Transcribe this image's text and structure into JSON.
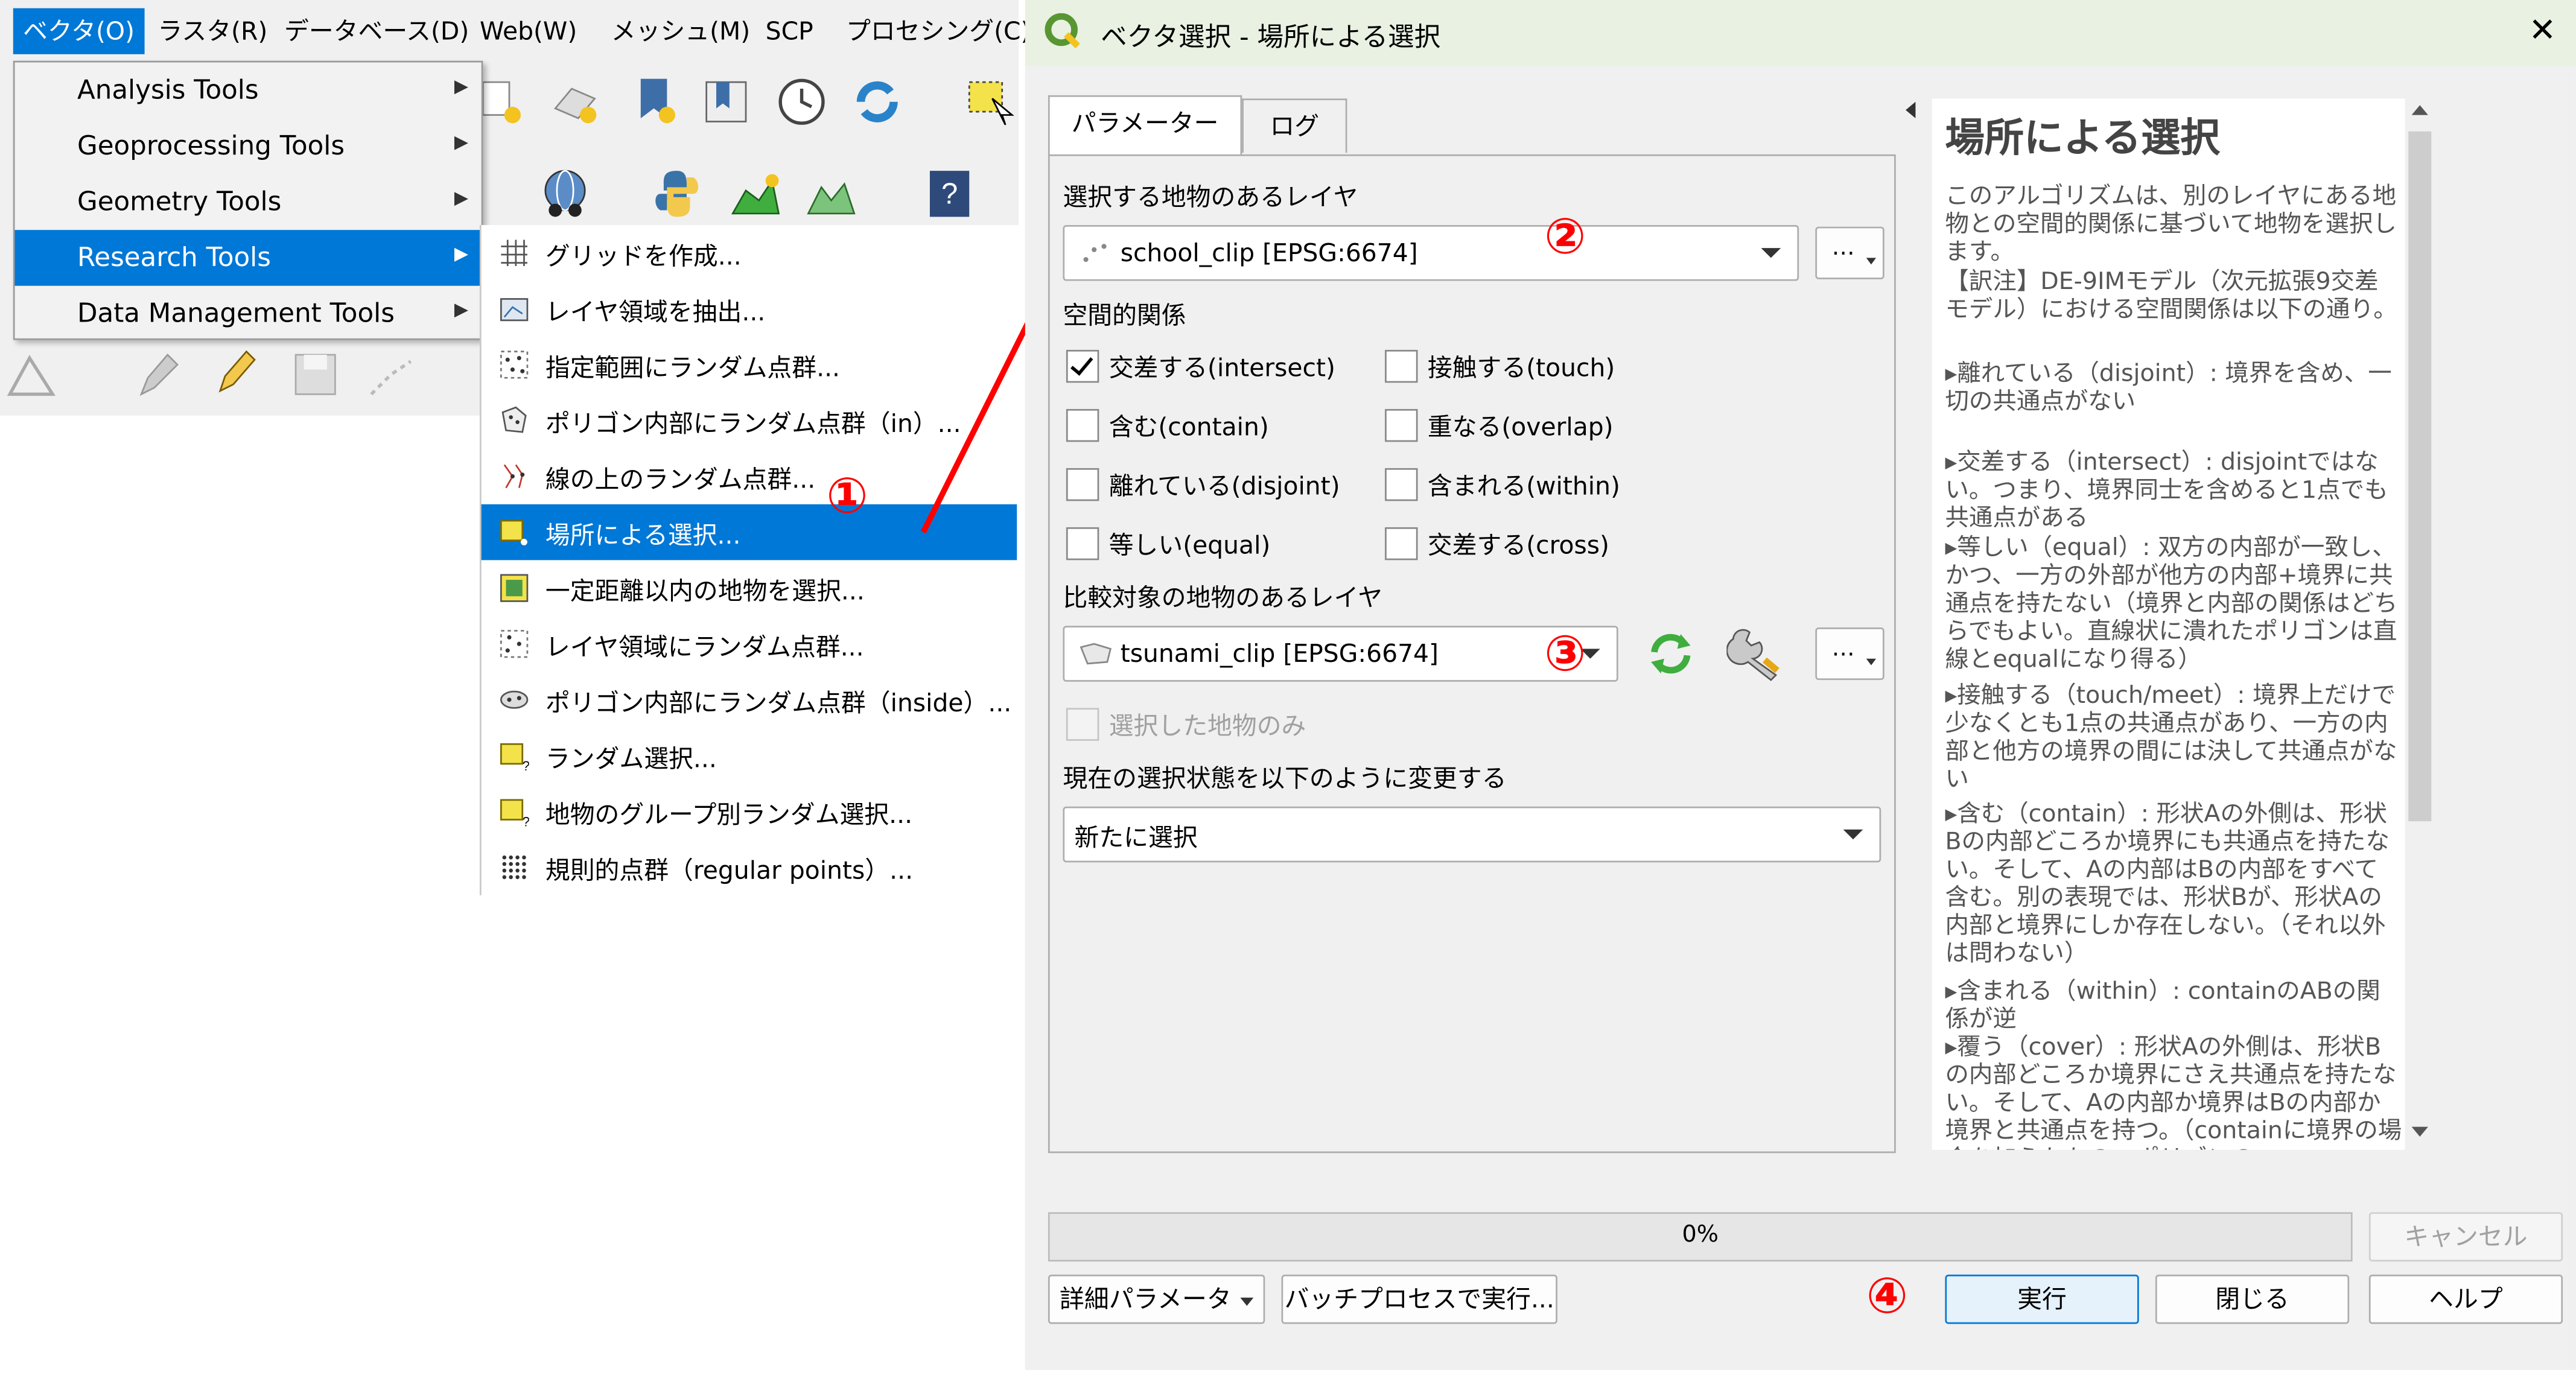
{
  "menubar": {
    "items": [
      "ベクタ(O)",
      "ラスタ(R)",
      "データベース(D)",
      "Web(W)",
      "メッシュ(M)",
      "SCP",
      "プロセシング(C)"
    ],
    "active_index": 0
  },
  "vector_menu": {
    "items": [
      {
        "label": "Analysis Tools"
      },
      {
        "label": "Geoprocessing Tools"
      },
      {
        "label": "Geometry Tools"
      },
      {
        "label": "Research Tools"
      },
      {
        "label": "Data Management Tools"
      }
    ],
    "selected_index": 3
  },
  "research_submenu": {
    "items": [
      {
        "label": "グリッドを作成...",
        "icon": "grid-icon"
      },
      {
        "label": "レイヤ領域を抽出...",
        "icon": "extent-icon"
      },
      {
        "label": "指定範囲にランダム点群...",
        "icon": "random-points-icon"
      },
      {
        "label": "ポリゴン内部にランダム点群（in）...",
        "icon": "random-in-polygon-icon"
      },
      {
        "label": "線の上のランダム点群...",
        "icon": "random-on-line-icon"
      },
      {
        "label": "場所による選択...",
        "icon": "select-by-location-icon"
      },
      {
        "label": "一定距離以内の地物を選択...",
        "icon": "select-within-distance-icon"
      },
      {
        "label": "レイヤ領域にランダム点群...",
        "icon": "random-in-extent-icon"
      },
      {
        "label": "ポリゴン内部にランダム点群（inside）...",
        "icon": "random-inside-polygon-icon"
      },
      {
        "label": "ランダム選択...",
        "icon": "random-select-icon"
      },
      {
        "label": "地物のグループ別ランダム選択...",
        "icon": "random-select-group-icon"
      },
      {
        "label": "規則的点群（regular points）...",
        "icon": "regular-points-icon"
      }
    ],
    "selected_index": 5
  },
  "annotations": {
    "step1": "①",
    "step2": "②",
    "step3": "③",
    "step4": "④"
  },
  "dialog": {
    "title": "ベクタ選択 - 場所による選択",
    "close_label": "✕",
    "tabs": [
      "パラメーター",
      "ログ"
    ],
    "active_tab": 0,
    "input_layer": {
      "label": "選択する地物のあるレイヤ",
      "value": "school_clip [EPSG:6674]"
    },
    "predicate": {
      "label": "空間的関係",
      "options": [
        {
          "label": "交差する(intersect)",
          "checked": true
        },
        {
          "label": "接触する(touch)",
          "checked": false
        },
        {
          "label": "含む(contain)",
          "checked": false
        },
        {
          "label": "重なる(overlap)",
          "checked": false
        },
        {
          "label": "離れている(disjoint)",
          "checked": false
        },
        {
          "label": "含まれる(within)",
          "checked": false
        },
        {
          "label": "等しい(equal)",
          "checked": false
        },
        {
          "label": "交差する(cross)",
          "checked": false
        }
      ]
    },
    "intersect_layer": {
      "label": "比較対象の地物のあるレイヤ",
      "value": "tsunami_clip [EPSG:6674]"
    },
    "selected_only": {
      "label": "選択した地物のみ",
      "checked": false
    },
    "method": {
      "label": "現在の選択状態を以下のように変更する",
      "value": "新たに選択"
    },
    "more_label": "…",
    "help": {
      "title": "場所による選択",
      "paragraphs": [
        "このアルゴリズムは、別のレイヤにある地物との空間的関係に基づいて地物を選択します。",
        "【訳注】DE-9IMモデル（次元拡張9交差モデル）における空間関係は以下の通り。",
        "▸離れている（disjoint）: 境界を含め、一切の共通点がない",
        "▸交差する（intersect）: disjointではない。つまり、境界同士を含めると1点でも共通点がある",
        "▸等しい（equal）: 双方の内部が一致し、かつ、一方の外部が他方の内部+境界に共通点を持たない（境界と内部の関係はどちらでもよい。直線状に潰れたポリゴンは直線とequalになり得る）",
        "▸接触する（touch/meet）: 境界上だけで少なくとも1点の共通点があり、一方の内部と他方の境界の間には決して共通点がない",
        "▸含む（contain）: 形状Aの外側は、形状Bの内部どころか境界にも共通点を持たない。そして、Aの内部はBの内部をすべて含む。別の表現では、形状Bが、形状Aの内部と境界にしか存在しない。（それ以外は問わない）",
        "▸含まれる（within）: containのABの関係が逆",
        "▸覆う（cover）: 形状Aの外側は、形状Bの内部どころか境界にさえ共通点を持たない。そして、Aの内部か境界はBの内部か境界と共通点を持つ。（containに境界の場合を加えたもの＝ポリゴンの"
      ]
    },
    "progress": {
      "value": 0,
      "text": "0%"
    },
    "buttons": {
      "cancel": "キャンセル",
      "advanced": "詳細パラメータ",
      "batch": "バッチプロセスで実行...",
      "run": "実行",
      "close": "閉じる",
      "help": "ヘルプ"
    }
  },
  "colors": {
    "accent": "#0078d7",
    "annotation": "#ff0000",
    "qgis_green": "#589632"
  }
}
